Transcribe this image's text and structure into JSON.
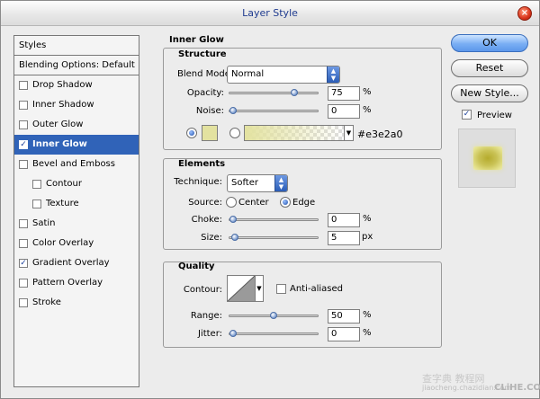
{
  "window": {
    "title": "Layer Style"
  },
  "styles_list": {
    "header": "Styles",
    "blending": "Blending Options: Default",
    "items": [
      {
        "label": "Drop Shadow",
        "checked": false,
        "selected": false,
        "indent": false
      },
      {
        "label": "Inner Shadow",
        "checked": false,
        "selected": false,
        "indent": false
      },
      {
        "label": "Outer Glow",
        "checked": false,
        "selected": false,
        "indent": false
      },
      {
        "label": "Inner Glow",
        "checked": true,
        "selected": true,
        "indent": false
      },
      {
        "label": "Bevel and Emboss",
        "checked": false,
        "selected": false,
        "indent": false
      },
      {
        "label": "Contour",
        "checked": false,
        "selected": false,
        "indent": true
      },
      {
        "label": "Texture",
        "checked": false,
        "selected": false,
        "indent": true
      },
      {
        "label": "Satin",
        "checked": false,
        "selected": false,
        "indent": false
      },
      {
        "label": "Color Overlay",
        "checked": false,
        "selected": false,
        "indent": false
      },
      {
        "label": "Gradient Overlay",
        "checked": true,
        "selected": false,
        "indent": false
      },
      {
        "label": "Pattern Overlay",
        "checked": false,
        "selected": false,
        "indent": false
      },
      {
        "label": "Stroke",
        "checked": false,
        "selected": false,
        "indent": false
      }
    ]
  },
  "inner_glow": {
    "title": "Inner Glow",
    "structure": {
      "title": "Structure",
      "blend_mode_label": "Blend Mode:",
      "blend_mode_value": "Normal",
      "opacity_label": "Opacity:",
      "opacity_value": "75",
      "opacity_level": 0.75,
      "opacity_unit": "%",
      "noise_label": "Noise:",
      "noise_value": "0",
      "noise_level": 0,
      "noise_unit": "%",
      "color_hex": "#e3e2a0"
    },
    "elements": {
      "title": "Elements",
      "technique_label": "Technique:",
      "technique_value": "Softer",
      "source_label": "Source:",
      "source_center": "Center",
      "source_edge": "Edge",
      "choke_label": "Choke:",
      "choke_value": "0",
      "choke_level": 0,
      "choke_unit": "%",
      "size_label": "Size:",
      "size_value": "5",
      "size_level": 0.02,
      "size_unit": "px"
    },
    "quality": {
      "title": "Quality",
      "contour_label": "Contour:",
      "anti_aliased_label": "Anti-aliased",
      "range_label": "Range:",
      "range_value": "50",
      "range_level": 0.5,
      "range_unit": "%",
      "jitter_label": "Jitter:",
      "jitter_value": "0",
      "jitter_level": 0,
      "jitter_unit": "%"
    }
  },
  "buttons": {
    "ok": "OK",
    "reset": "Reset",
    "new_style": "New Style...",
    "preview_label": "Preview"
  },
  "watermark": {
    "line1": "查字典 教程网",
    "line2": "jiaocheng.chazidian.com",
    "logo": "CLiHE.COM"
  },
  "colors": {
    "selection": "#3063b8",
    "glow": "#e3e2a0",
    "title_text": "#1f3b8f"
  }
}
